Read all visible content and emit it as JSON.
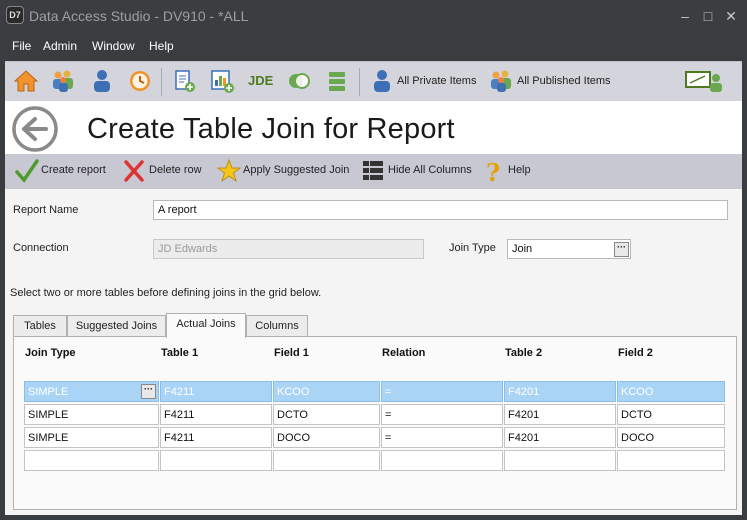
{
  "window": {
    "title": "Data Access Studio - DV910 - *ALL",
    "logo_text": "D7",
    "controls": {
      "minimize": "–",
      "maximize": "□",
      "close": "✕"
    }
  },
  "menu": [
    "File",
    "Admin",
    "Window",
    "Help"
  ],
  "toolbar": {
    "icons": [
      "home-icon",
      "users-group-icon",
      "user-icon",
      "clock-icon",
      "report-add-icon",
      "chart-add-icon",
      "jde-icon",
      "toggle-icon",
      "list-icon"
    ],
    "jde_text": "JDE",
    "all_private": "All Private Items",
    "all_published": "All Published Items",
    "right_icon": "presentation-user-icon"
  },
  "header": {
    "title": "Create Table Join for Report"
  },
  "actions": {
    "create_report": "Create report",
    "delete_row": "Delete row",
    "apply_suggested": "Apply Suggested Join",
    "hide_columns": "Hide All Columns",
    "help": "Help"
  },
  "form": {
    "report_name_label": "Report Name",
    "report_name_value": "A report",
    "connection_label": "Connection",
    "connection_value": "JD Edwards",
    "join_type_label": "Join Type",
    "join_type_value": "Join",
    "ellipsis": "···",
    "hint": "Select two or more tables before defining joins in the grid below."
  },
  "tabs": [
    {
      "label": "Tables",
      "active": false
    },
    {
      "label": "Suggested Joins",
      "active": false
    },
    {
      "label": "Actual Joins",
      "active": true
    },
    {
      "label": "Columns",
      "active": false
    }
  ],
  "grid": {
    "columns": [
      "Join Type",
      "Table 1",
      "Field 1",
      "Relation",
      "Table 2",
      "Field 2"
    ],
    "rows": [
      [
        "SIMPLE",
        "F4211",
        "KCOO",
        "=",
        "F4201",
        "KCOO"
      ],
      [
        "SIMPLE",
        "F4211",
        "DCTO",
        "=",
        "F4201",
        "DCTO"
      ],
      [
        "SIMPLE",
        "F4211",
        "DOCO",
        "=",
        "F4201",
        "DOCO"
      ],
      [
        "",
        "",
        "",
        "",
        "",
        ""
      ]
    ],
    "selected_row": 0
  },
  "colors": {
    "accent": "#a9d4f6",
    "toolbar": "#d4d4dc",
    "actionbar": "#c7c8d2"
  }
}
